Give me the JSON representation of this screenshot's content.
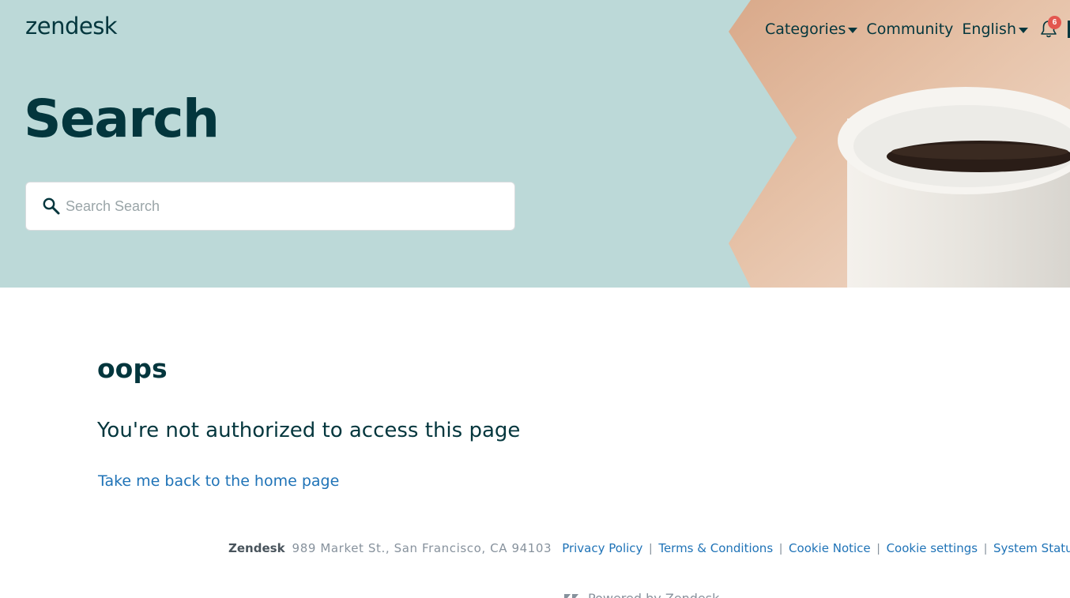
{
  "header": {
    "logo": "zendesk",
    "nav": {
      "categories": "Categories",
      "community": "Community",
      "language": "English"
    },
    "notifications_count": "6",
    "icons": [
      "bell-icon",
      "chevron-down-icon",
      "search-icon"
    ]
  },
  "hero": {
    "title": "Search",
    "search_placeholder": "Search Search"
  },
  "main": {
    "heading": "oops",
    "message": "You're not authorized to access this page",
    "home_link": "Take me back to the home page"
  },
  "footer": {
    "brand": "Zendesk",
    "address": "989 Market St., San Francisco, CA 94103",
    "links": [
      "Privacy Policy",
      "Terms & Conditions",
      "Cookie Notice",
      "Cookie settings",
      "System Status"
    ],
    "powered_by": "Powered by Zendesk"
  },
  "colors": {
    "hero_bg": "#bcd9d8",
    "text_dark": "#03363d",
    "link": "#1f73b7",
    "badge": "#e3564f",
    "muted": "#87929d"
  }
}
